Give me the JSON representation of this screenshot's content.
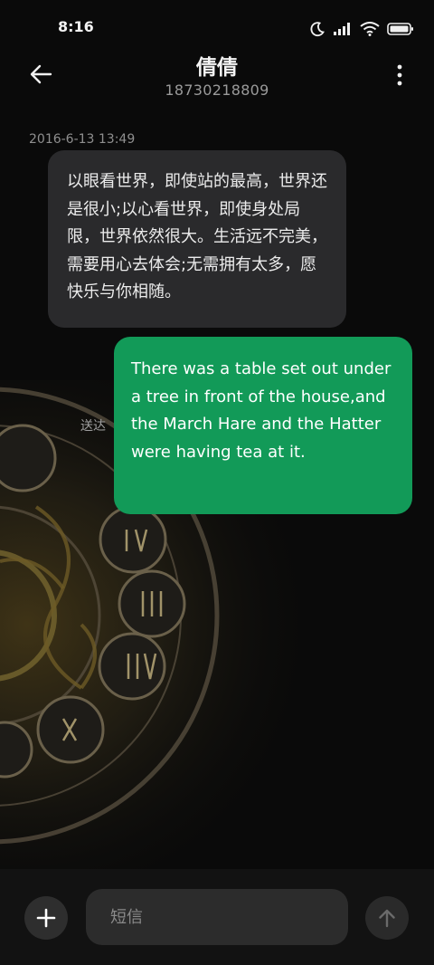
{
  "status_bar": {
    "time": "8:16"
  },
  "header": {
    "contact_name": "倩倩",
    "contact_number": "18730218809"
  },
  "conversation": {
    "timestamp": "2016-6-13 13:49",
    "incoming_message": "以眼看世界，即使站的最高，世界还是很小;以心看世界，即使身处局限，世界依然很大。生活远不完美，需要用心去体会;无需拥有太多，愿快乐与你相随。",
    "outgoing_message": "There was a table set out under a tree in front of the house,and the March Hare and the Hatter were having tea at it.",
    "delivery_status": "送达"
  },
  "composer": {
    "placeholder": "短信"
  },
  "colors": {
    "outgoing_bubble": "#129a58",
    "incoming_bubble": "#2a2a2c",
    "background": "#0a0a0a"
  },
  "icons": {
    "back": "arrow-left-icon",
    "more": "more-vertical-icon",
    "add": "plus-icon",
    "send": "arrow-up-icon"
  }
}
